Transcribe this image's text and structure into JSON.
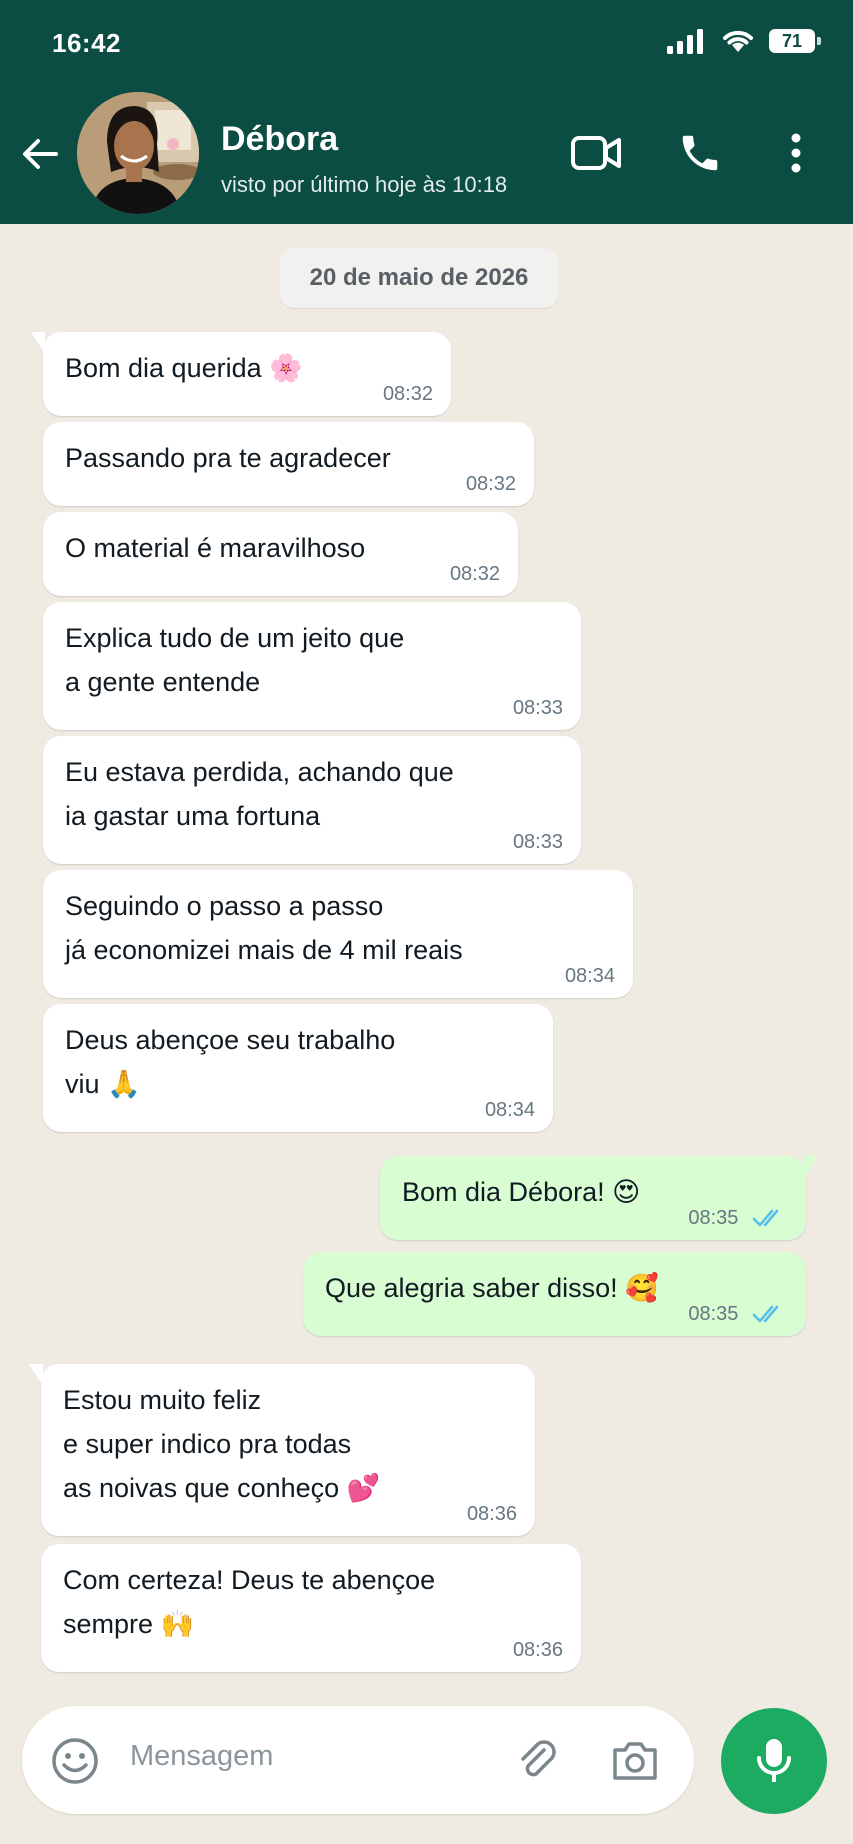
{
  "status_bar": {
    "time": "16:42",
    "battery": "71"
  },
  "header": {
    "contact_name": "Débora",
    "last_seen": "visto por último hoje às 10:18"
  },
  "date_separator": "20 de maio de 2026",
  "messages": [
    {
      "dir": "in",
      "text": "Bom dia querida 🌸",
      "time": "08:32"
    },
    {
      "dir": "in",
      "text": "Passando pra te agradecer",
      "time": "08:32"
    },
    {
      "dir": "in",
      "text": "O material é maravilhoso",
      "time": "08:32"
    },
    {
      "dir": "in",
      "text": "Explica tudo de um jeito que\na gente entende",
      "time": "08:33"
    },
    {
      "dir": "in",
      "text": "Eu estava perdida, achando que\nia gastar uma fortuna",
      "time": "08:33"
    },
    {
      "dir": "in",
      "text": "Seguindo o passo a passo\njá economizei mais de 4 mil reais",
      "time": "08:34"
    },
    {
      "dir": "in",
      "text": "Deus abençoe seu trabalho\nviu 🙏",
      "time": "08:34"
    },
    {
      "dir": "out",
      "text": "Bom dia Débora! 😍",
      "time": "08:35",
      "read": true
    },
    {
      "dir": "out",
      "text": "Que alegria saber disso! 🥰",
      "time": "08:35",
      "read": true
    },
    {
      "dir": "in",
      "text": "Estou muito feliz\ne super indico pra todas\nas noivas que conheço 💕",
      "time": "08:36"
    },
    {
      "dir": "in",
      "text": "Com certeza! Deus te abençoe\nsempre 🙌",
      "time": "08:36"
    }
  ],
  "composer": {
    "placeholder": "Mensagem"
  },
  "colors": {
    "header": "#0b4d42",
    "outgoing": "#d9fdd3",
    "incoming": "#ffffff",
    "mic": "#1daa61",
    "tick": "#53bdeb"
  }
}
